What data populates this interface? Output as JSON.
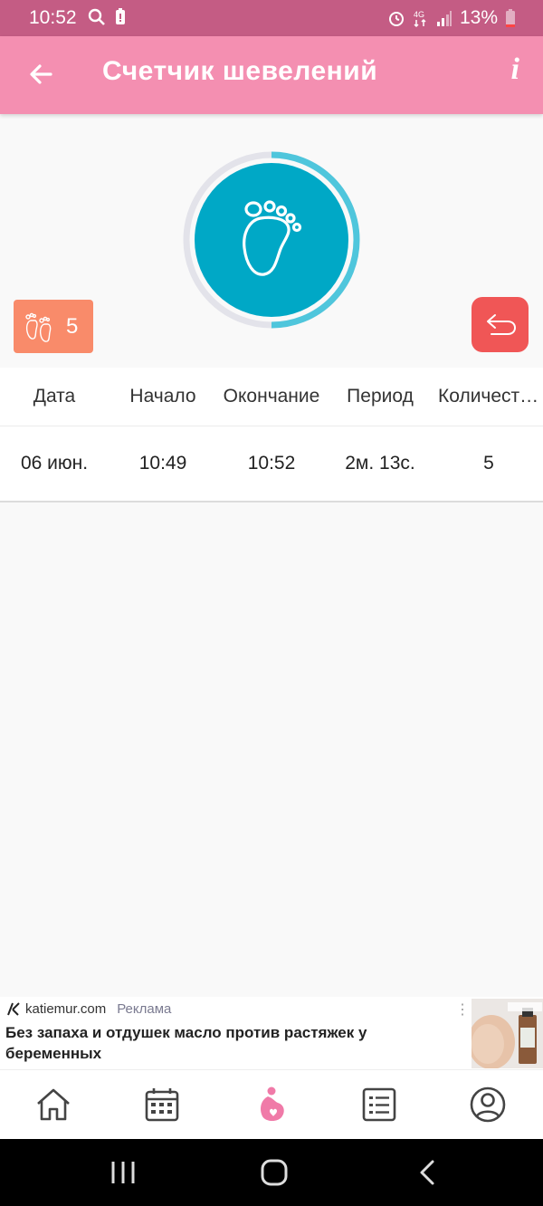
{
  "status_bar": {
    "time": "10:52",
    "battery": "13%"
  },
  "app_bar": {
    "title": "Счетчик шевелений",
    "info_label": "i"
  },
  "counter": {
    "value": "5",
    "ring_progress": 0.5
  },
  "table": {
    "headers": [
      "Дата",
      "Начало",
      "Окончание",
      "Период",
      "Количест…"
    ],
    "rows": [
      [
        "06 июн.",
        "10:49",
        "10:52",
        "2м. 13с.",
        "5"
      ]
    ]
  },
  "ad": {
    "source": "katiemur.com",
    "label": "Реклама",
    "headline": "Без запаха и отдушек масло против растяжек у беременных"
  },
  "colors": {
    "status_bar": "#c45c84",
    "app_bar": "#f48fb1",
    "ring_fill": "#00a8c6",
    "ring_progress": "#4fc6dc",
    "badge": "#f98b6a",
    "undo": "#f05656",
    "nav_active": "#f07aa8"
  },
  "icons": {
    "back": "arrow-left-icon",
    "info": "info-icon",
    "foot": "foot-icon",
    "undo": "undo-icon",
    "nav": [
      "home-icon",
      "calendar-icon",
      "pregnancy-icon",
      "list-icon",
      "profile-icon"
    ]
  }
}
